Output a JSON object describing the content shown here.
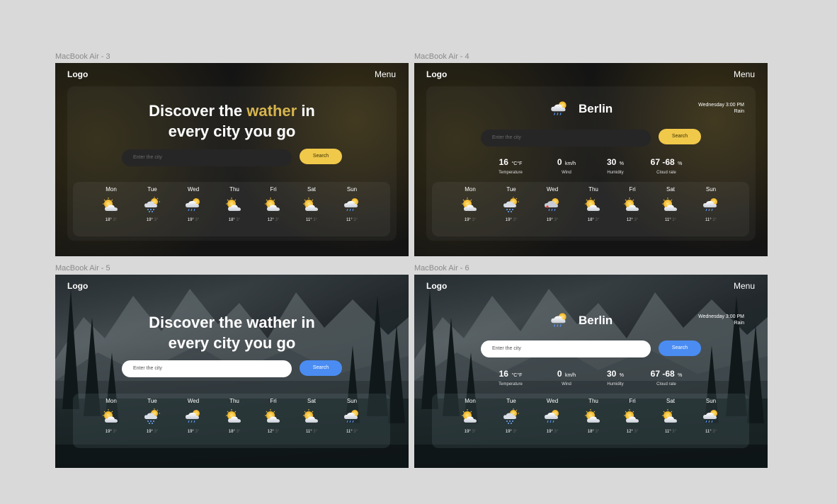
{
  "frames": [
    {
      "label": "MacBook Air - 3"
    },
    {
      "label": "MacBook Air - 4"
    },
    {
      "label": "MacBook Air - 5"
    },
    {
      "label": "MacBook Air - 6"
    }
  ],
  "nav": {
    "logo": "Logo",
    "menu": "Menu"
  },
  "hero": {
    "line1_pre": "Discover the ",
    "line1_highlight": "wather",
    "line1_post": " in",
    "line2": "every city you go",
    "line1_plain": "Discover the wather in"
  },
  "search": {
    "placeholder": "Enter the city",
    "button": "Search"
  },
  "city": {
    "name": "Berlin",
    "datetime": "Wednesday 3:00 PM",
    "condition": "Rain"
  },
  "stats": [
    {
      "value": "16",
      "unit": "°C°F",
      "label": "Temperature"
    },
    {
      "value": "0",
      "unit": "km/h",
      "label": "Wind"
    },
    {
      "value": "30",
      "unit": "%",
      "label": "Humidity"
    },
    {
      "value": "67 -68",
      "unit": "%",
      "label": "Cloud rate"
    }
  ],
  "forecast_a": [
    {
      "day": "Mon",
      "hi": "18°",
      "lo": "3°",
      "icon": "sun-cloud-icon"
    },
    {
      "day": "Tue",
      "hi": "19°",
      "lo": "3°",
      "icon": "sun-snow-icon"
    },
    {
      "day": "Wed",
      "hi": "19°",
      "lo": "3°",
      "icon": "sun-rain-icon"
    },
    {
      "day": "Thu",
      "hi": "18°",
      "lo": "3°",
      "icon": "sun-cloud-icon"
    },
    {
      "day": "Fri",
      "hi": "12°",
      "lo": "3°",
      "icon": "sun-cloud-icon"
    },
    {
      "day": "Sat",
      "hi": "11°",
      "lo": "3°",
      "icon": "sun-cloud-icon"
    },
    {
      "day": "Sun",
      "hi": "11°",
      "lo": "3°",
      "icon": "sun-rain-icon"
    }
  ],
  "forecast_b": [
    {
      "day": "Mon",
      "hi": "19°",
      "lo": "3°",
      "icon": "sun-cloud-icon"
    },
    {
      "day": "Tue",
      "hi": "19°",
      "lo": "3°",
      "icon": "sun-snow-icon"
    },
    {
      "day": "Wed",
      "hi": "19°",
      "lo": "3°",
      "icon": "cloud-rain-icon"
    },
    {
      "day": "Thu",
      "hi": "18°",
      "lo": "3°",
      "icon": "sun-cloud-icon"
    },
    {
      "day": "Fri",
      "hi": "12°",
      "lo": "3°",
      "icon": "sun-cloud-icon"
    },
    {
      "day": "Sat",
      "hi": "11°",
      "lo": "3°",
      "icon": "sun-cloud-icon"
    },
    {
      "day": "Sun",
      "hi": "11°",
      "lo": "3°",
      "icon": "sun-rain-icon"
    }
  ],
  "colors": {
    "accent_yellow": "#f0c84a",
    "accent_blue": "#4a8cf2",
    "highlight_text": "#d6b54e"
  }
}
